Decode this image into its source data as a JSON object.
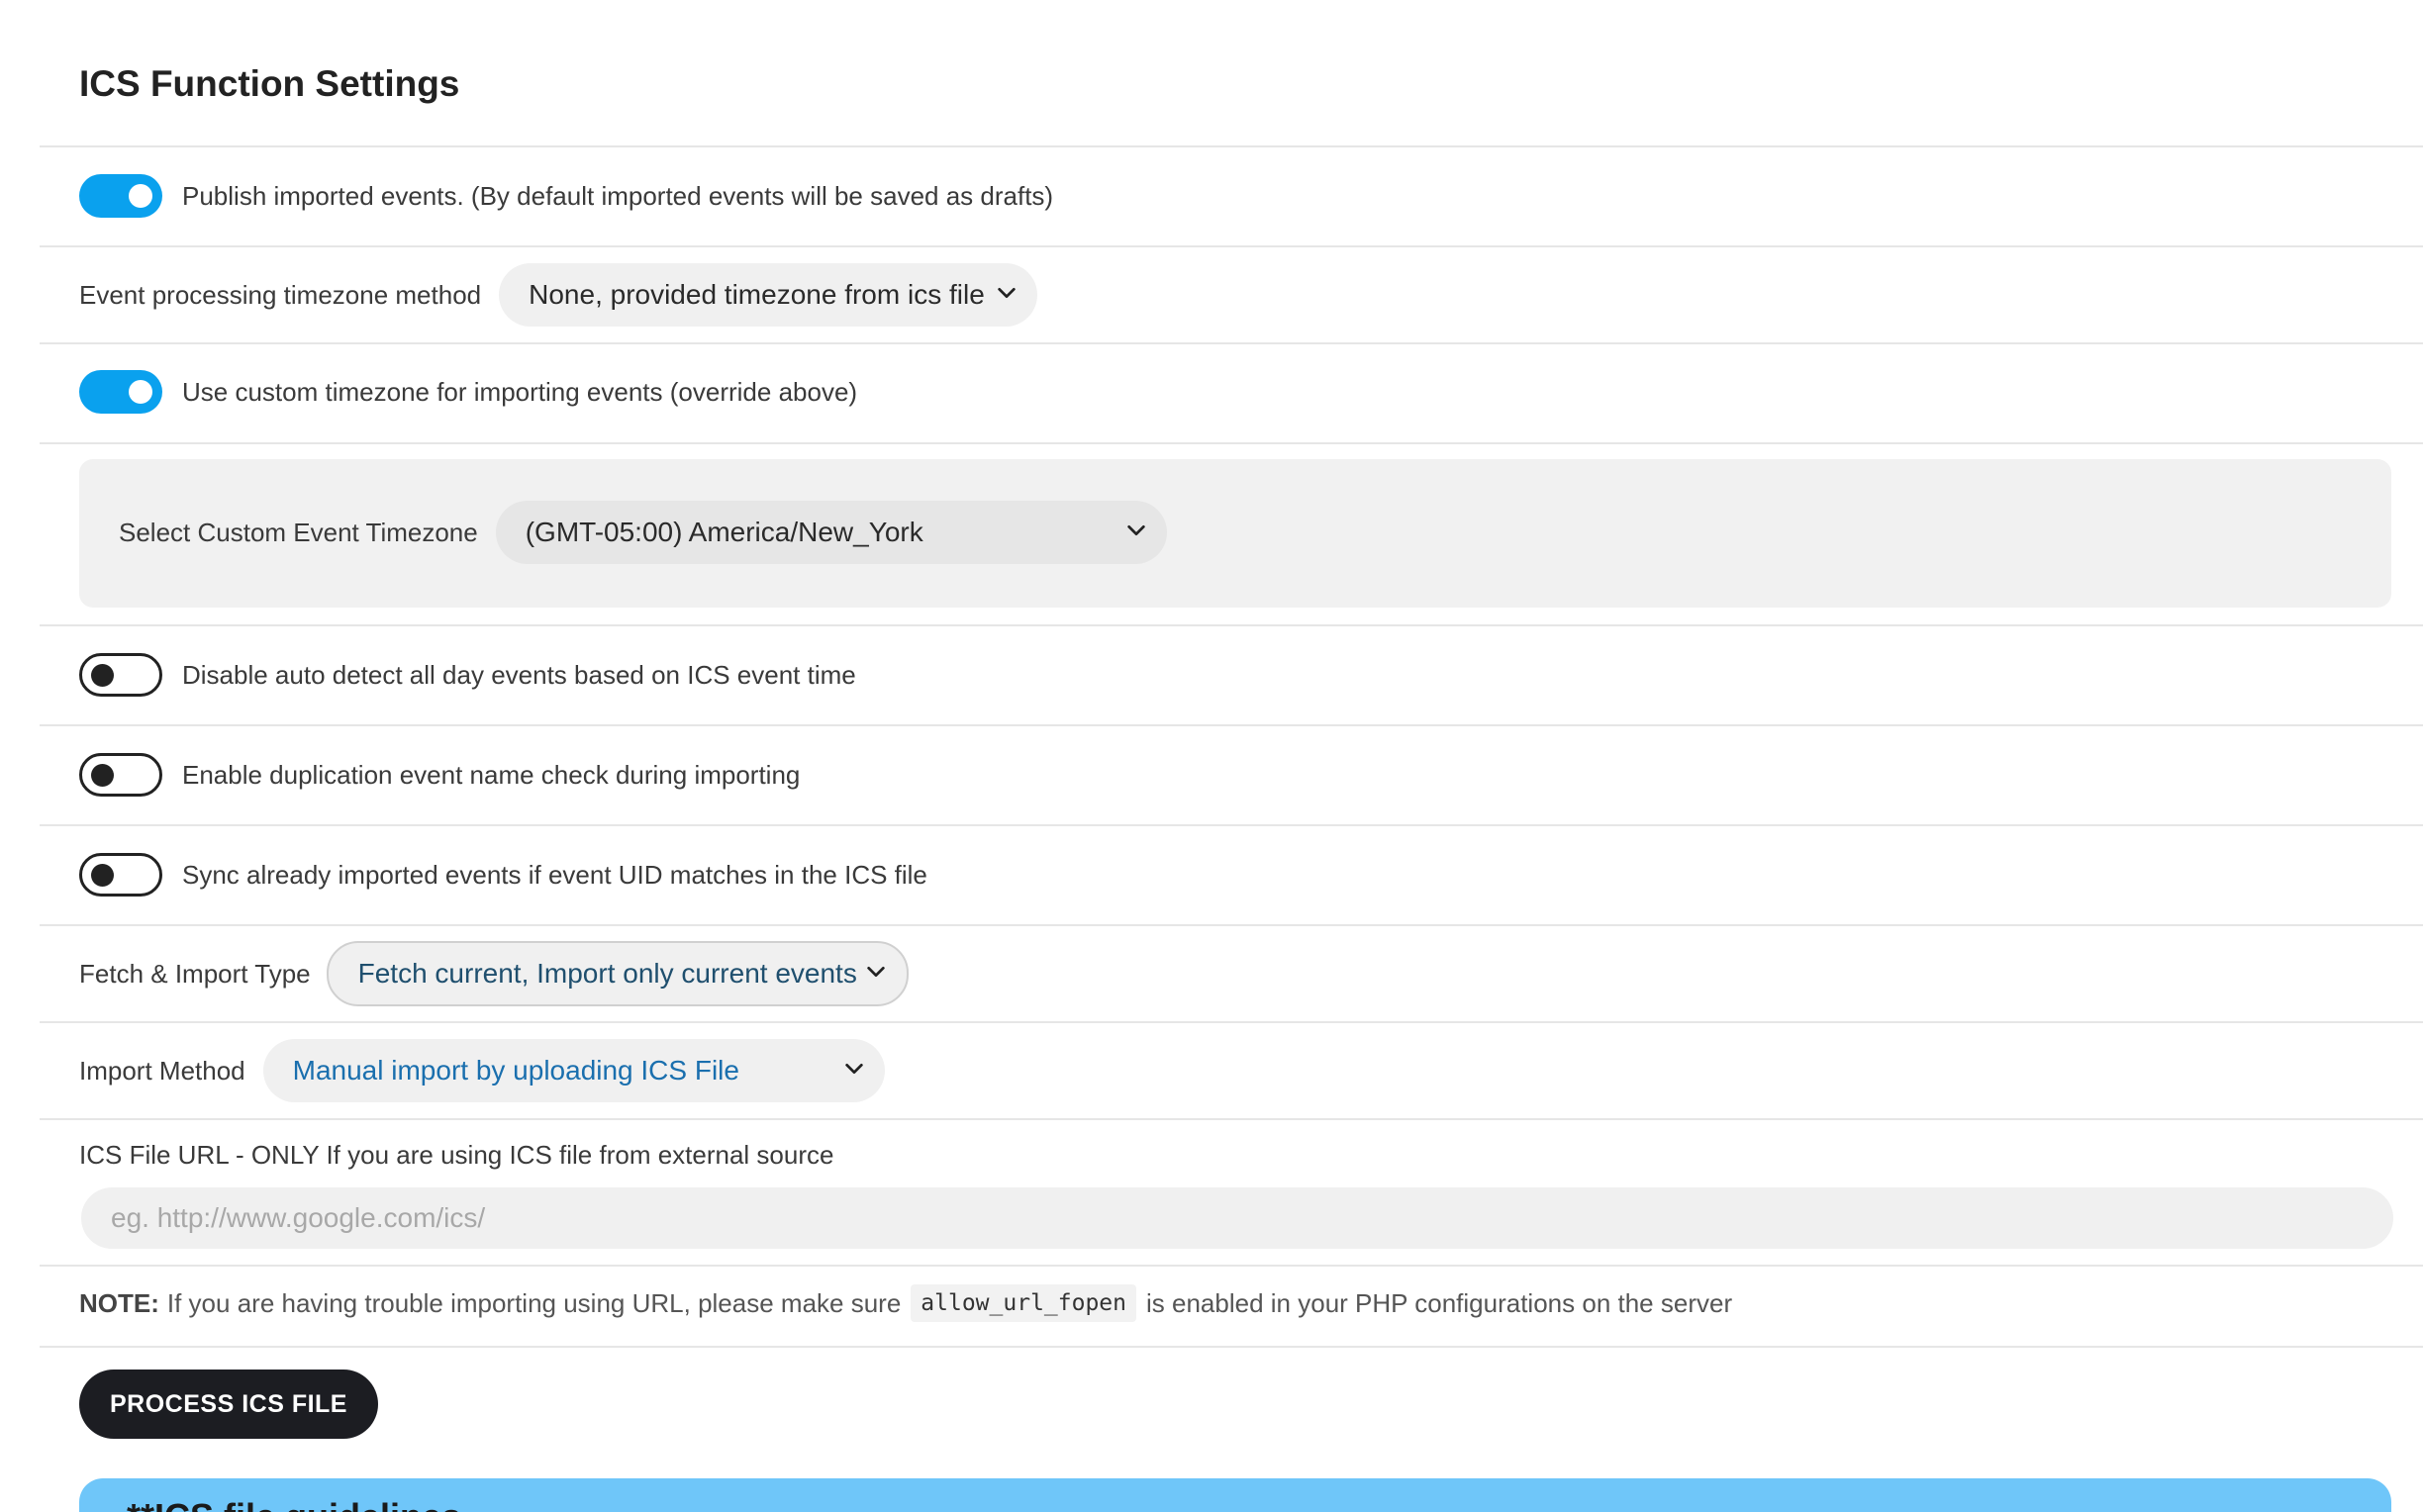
{
  "header": {
    "title": "ICS Function Settings"
  },
  "settings": {
    "publish": {
      "label": "Publish imported events. (By default imported events will be saved as drafts)",
      "state": "on"
    },
    "timezone_method": {
      "label": "Event processing timezone method",
      "selected": "None, provided timezone from ics file"
    },
    "custom_timezone": {
      "label": "Use custom timezone for importing events (override above)",
      "state": "on"
    },
    "custom_timezone_select": {
      "label": "Select Custom Event Timezone",
      "selected": "(GMT-05:00) America/New_York"
    },
    "disable_all_day": {
      "label": "Disable auto detect all day events based on ICS event time",
      "state": "off"
    },
    "duplication_check": {
      "label": "Enable duplication event name check during importing",
      "state": "off"
    },
    "sync_uid": {
      "label": "Sync already imported events if event UID matches in the ICS file",
      "state": "off"
    },
    "fetch_import_type": {
      "label": "Fetch & Import Type",
      "selected": "Fetch current, Import only current events"
    },
    "import_method": {
      "label": "Import Method",
      "selected": "Manual import by uploading ICS File"
    },
    "ics_url": {
      "label": "ICS File URL - ONLY If you are using ICS file from external source",
      "placeholder": "eg. http://www.google.com/ics/",
      "value": ""
    }
  },
  "note": {
    "prefix": "NOTE:",
    "text_before": "If you are having trouble importing using URL, please make sure",
    "code": "allow_url_fopen",
    "text_after": "is enabled in your PHP configurations on the server"
  },
  "actions": {
    "process_label": "PROCESS ICS FILE"
  },
  "guide": {
    "title": "**ICS file guidelines"
  },
  "colors": {
    "toggle_on": "#0aa1ee",
    "button_dark": "#1c1d22",
    "guide_bar": "#6fc6f9",
    "link_blue": "#1a6fae"
  }
}
